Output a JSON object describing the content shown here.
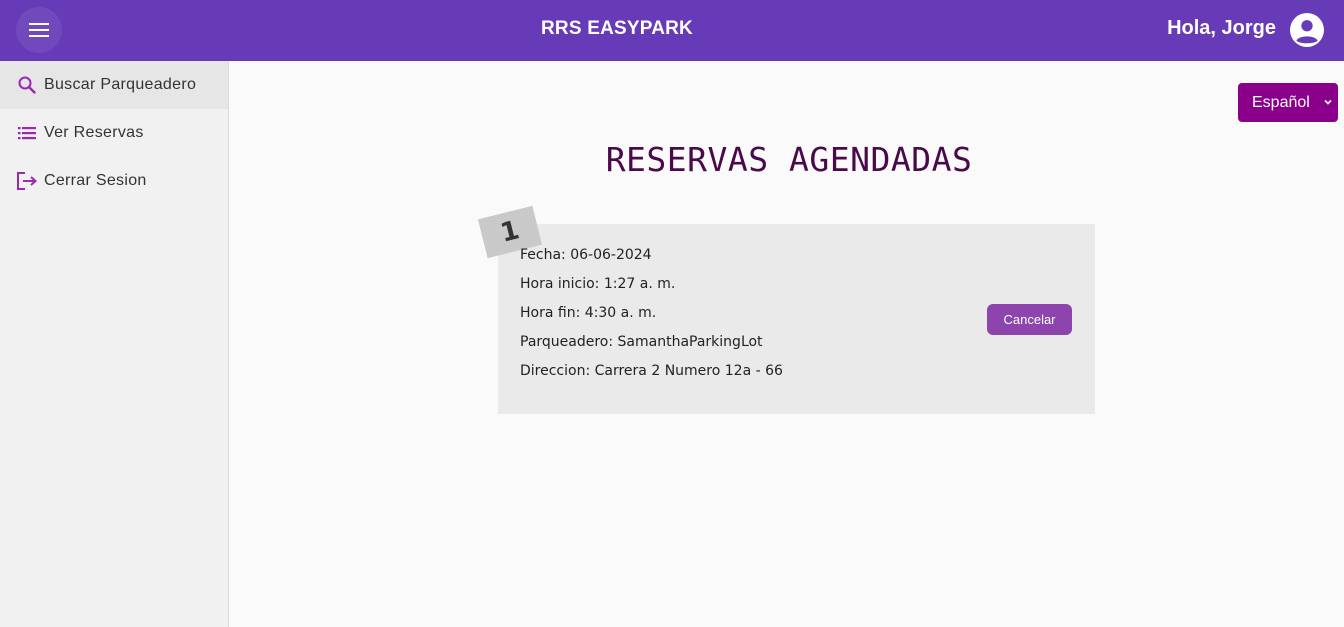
{
  "header": {
    "title": "RRS EASYPARK",
    "greeting": "Hola, Jorge",
    "menu_icon": "menu-icon",
    "account_icon": "account-circle-icon",
    "color": "#673ab7"
  },
  "sidebar": {
    "items": [
      {
        "label": "Buscar Parqueadero",
        "icon": "search-icon"
      },
      {
        "label": "Ver Reservas",
        "icon": "list-icon"
      },
      {
        "label": "Cerrar Sesion",
        "icon": "logout-icon"
      }
    ]
  },
  "language": {
    "selected": "Español",
    "color": "#8b008b"
  },
  "main": {
    "title": "RESERVAS AGENDADAS",
    "reservations": [
      {
        "number": "1",
        "fecha": "Fecha: 06-06-2024",
        "hora_inicio": "Hora inicio: 1:27 a. m.",
        "hora_fin": "Hora fin: 4:30 a. m.",
        "parqueadero": "Parqueadero: SamanthaParkingLot",
        "direccion": "Direccion: Carrera 2 Numero 12a - 66",
        "cancel_label": "Cancelar"
      }
    ]
  }
}
